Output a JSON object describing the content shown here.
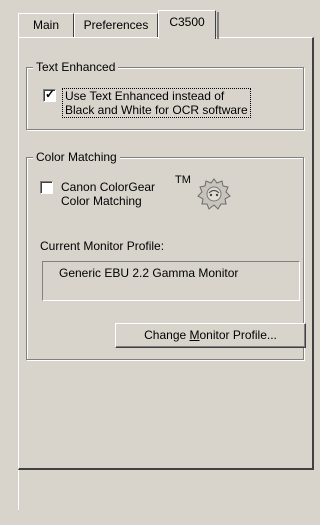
{
  "tabs": [
    {
      "label": "Main"
    },
    {
      "label": "Preferences"
    },
    {
      "label": "C3500"
    }
  ],
  "text_enhanced": {
    "legend": "Text Enhanced",
    "checked": true,
    "label_line1": "Use Text Enhanced instead of",
    "label_line2": "Black and White for OCR software"
  },
  "color_matching": {
    "legend": "Color Matching",
    "checked": false,
    "label_line1": "Canon ColorGear",
    "label_line2": "Color Matching",
    "trademark": "TM",
    "logo_icon": "colorgear-logo-icon",
    "current_profile_label": "Current Monitor Profile:",
    "current_profile_value": "Generic EBU 2.2 Gamma Monitor",
    "change_button": {
      "before": "Change ",
      "mnemonic": "M",
      "after": "onitor Profile..."
    }
  }
}
